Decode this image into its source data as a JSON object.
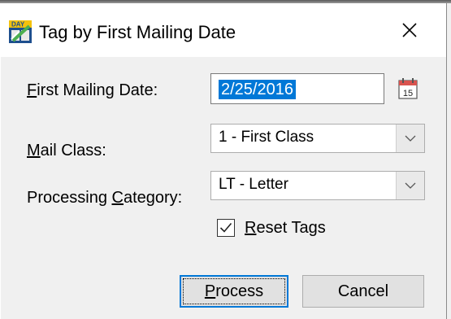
{
  "window": {
    "title": "Tag by First Mailing Date",
    "close_glyph": "✕",
    "icon": "app-calendar-icon"
  },
  "form": {
    "first_mailing_date": {
      "label_hotkey": "F",
      "label_rest": "irst Mailing Date:",
      "value": "2/25/2016",
      "calendar_icon_day": "15"
    },
    "mail_class": {
      "label_hotkey": "M",
      "label_rest": "ail Class:",
      "value": "1 - First Class"
    },
    "processing_category": {
      "label_prefix": "Processing ",
      "label_hotkey": "C",
      "label_rest": "ategory:",
      "value": "LT - Letter"
    },
    "reset_tags": {
      "checked": true,
      "label_hotkey": "R",
      "label_rest": "eset Tags"
    }
  },
  "buttons": {
    "process": {
      "hotkey": "P",
      "rest": "rocess"
    },
    "cancel": {
      "label": "Cancel"
    }
  },
  "colors": {
    "accent": "#0078d7",
    "client_bg": "#f0f0f0",
    "button_bg": "#e1e1e1"
  }
}
